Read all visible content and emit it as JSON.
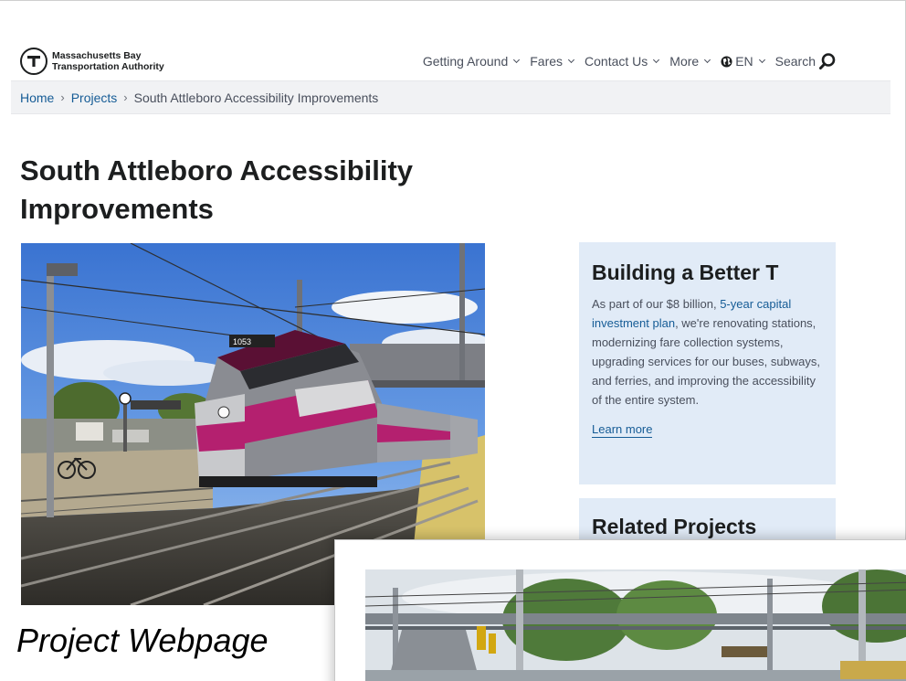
{
  "header": {
    "logo_line1": "Massachusetts Bay",
    "logo_line2": "Transportation Authority",
    "nav": [
      {
        "label": "Getting Around"
      },
      {
        "label": "Fares"
      },
      {
        "label": "Contact Us"
      },
      {
        "label": "More"
      }
    ],
    "language": "EN",
    "search_label": "Search"
  },
  "breadcrumb": {
    "home": "Home",
    "projects": "Projects",
    "current": "South Attleboro Accessibility Improvements",
    "separator": "›"
  },
  "page": {
    "title_line1": "South Attleboro Accessibility",
    "title_line2": "Improvements"
  },
  "sidebar": {
    "title": "Building a Better T",
    "body_prefix": "As part of our $8 billion, ",
    "body_link": "5-year capital investment plan",
    "body_suffix": ", we're renovating stations, modernizing fare collection systems, upgrading services for our buses, subways, and ferries, and improving the accessibility of the entire system.",
    "learn_more": "Learn more"
  },
  "related": {
    "title": "Related Projects"
  },
  "caption": "Project Webpage",
  "colors": {
    "link": "#165c96",
    "card_bg": "#e1ebf7",
    "breadcrumb_bg": "#f1f2f4",
    "train_magenta": "#b4206f"
  },
  "icons": [
    "mbta-t-logo-icon",
    "chevron-down-icon",
    "globe-icon",
    "search-icon"
  ]
}
